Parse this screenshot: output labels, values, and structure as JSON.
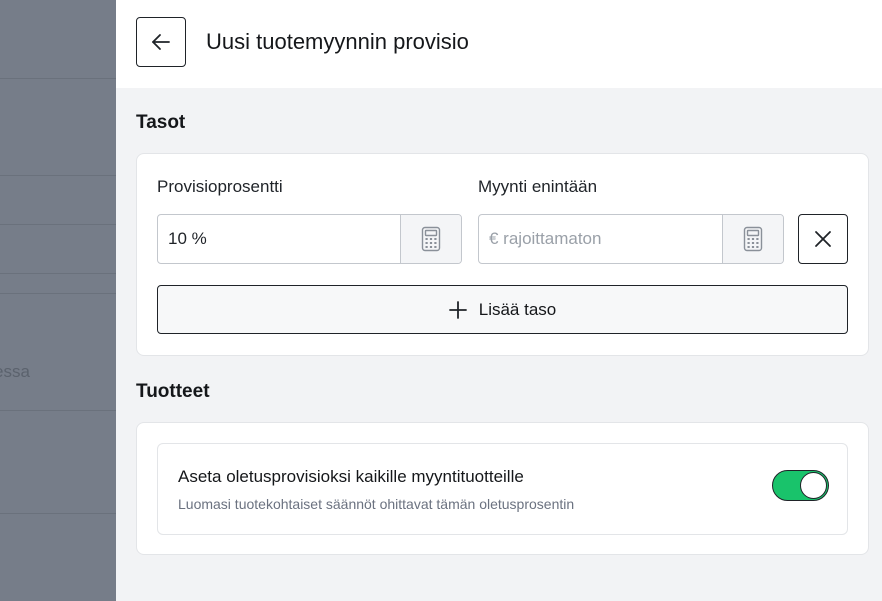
{
  "backdrop": {
    "partial_text": "essa"
  },
  "drawer": {
    "title": "Uusi tuotemyynnin provisio"
  },
  "tiers": {
    "section_title": "Tasot",
    "commission_label": "Provisioprosentti",
    "commission_value": "10 %",
    "max_sales_label": "Myynti enintään",
    "max_sales_placeholder": "€ rajoittamaton",
    "add_tier_label": "Lisää taso"
  },
  "products": {
    "section_title": "Tuotteet",
    "default_toggle_label": "Aseta oletusprovisioksi kaikille myyntituotteille",
    "default_toggle_description": "Luomasi tuotekohtaiset säännöt ohittavat tämän oletusprosentin",
    "default_toggle_on": true
  },
  "colors": {
    "toggle_on": "#19c36b",
    "backdrop": "#767d89"
  }
}
